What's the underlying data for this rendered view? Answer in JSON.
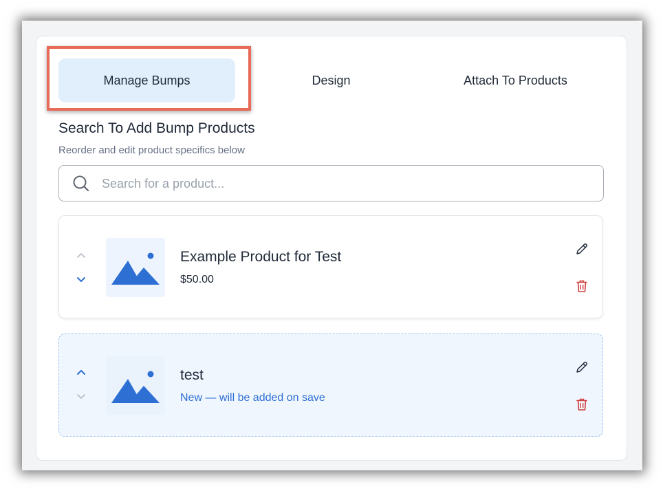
{
  "tabs": [
    {
      "label": "Manage Bumps",
      "active": true
    },
    {
      "label": "Design",
      "active": false
    },
    {
      "label": "Attach To Products",
      "active": false
    }
  ],
  "section": {
    "title": "Search To Add Bump Products",
    "subtitle": "Reorder and edit product specifics below"
  },
  "search": {
    "placeholder": "Search for a product...",
    "value": "",
    "icon": "search-icon"
  },
  "products": [
    {
      "name": "Example Product for Test",
      "meta": "$50.00",
      "status": "saved",
      "thumbnail_icon": "image-placeholder-icon"
    },
    {
      "name": "test",
      "meta": "New — will be added on save",
      "status": "new",
      "thumbnail_icon": "image-placeholder-icon"
    }
  ],
  "colors": {
    "accent": "#2e6fd4",
    "active_tab_bg": "#e1effd",
    "delete": "#d13b3b",
    "highlight_border": "#e86a58",
    "new_item_bg": "#eff6fe"
  }
}
